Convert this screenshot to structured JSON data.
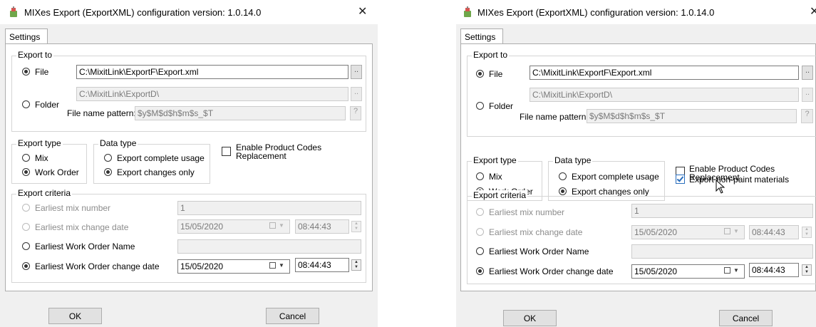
{
  "dialog": {
    "title": "MIXes Export (ExportXML) configuration version: 1.0.14.0",
    "close_glyph": "✕",
    "settings_tab": "Settings",
    "export_to": {
      "legend": "Export to",
      "file_label": "File",
      "file_path": "C:\\MixitLink\\ExportF\\Export.xml",
      "browse_label": "..",
      "folder_label": "Folder",
      "folder_path": "C:\\MixitLink\\ExportD\\",
      "pattern_label": "File name pattern:",
      "pattern_value": "$y$M$d$h$m$s_$T",
      "help_label": "?"
    },
    "export_type": {
      "legend": "Export type",
      "mix_label": "Mix",
      "work_order_label": "Work Order"
    },
    "data_type": {
      "legend": "Data type",
      "complete_label": "Export complete usage",
      "changes_label": "Export changes only"
    },
    "options": {
      "enable_codes_label_1": "Enable Product Codes",
      "enable_codes_label_2": "Replacement",
      "non_paint_label": "Export non-paint materials"
    },
    "criteria": {
      "legend": "Export criteria",
      "mix_number_label": "Earliest mix number",
      "mix_number_value": "1",
      "mix_change_date_label": "Earliest mix change date",
      "mix_change_date": "15/05/2020",
      "mix_change_time": "08:44:43",
      "wo_name_label": "Earliest Work Order Name",
      "wo_change_date_label": "Earliest Work Order change date",
      "wo_change_date": "15/05/2020",
      "wo_change_time": "08:44:43"
    },
    "ok_label": "OK",
    "cancel_label": "Cancel"
  },
  "icons": {
    "app": "mixer-app-icon",
    "close": "close-icon",
    "calendar": "calendar-icon",
    "cursor": "mouse-pointer-icon"
  },
  "colors": {
    "checkbox_accent": "#2a6ebd",
    "dialog_bg": "#f0f0f0"
  }
}
